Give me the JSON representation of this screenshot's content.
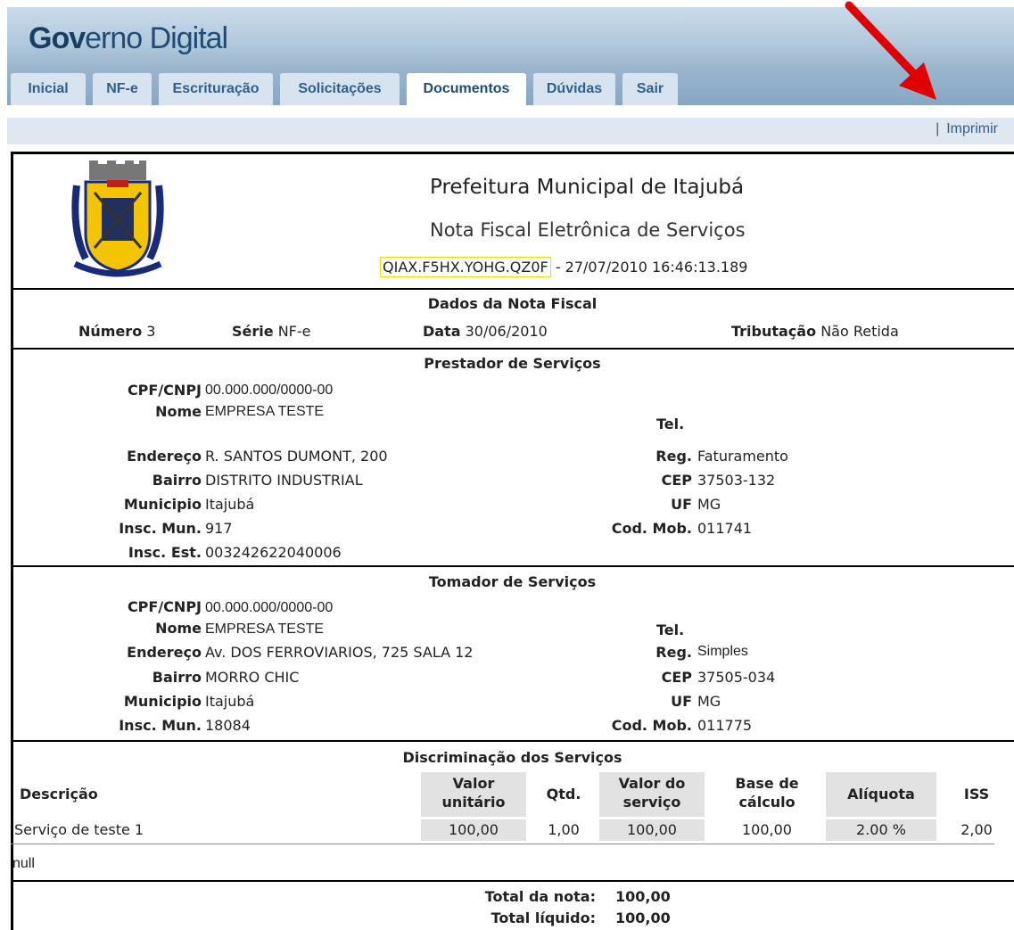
{
  "app": {
    "logo_bold": "Gov",
    "logo_rest": "erno Digital"
  },
  "tabs": [
    "Inicial",
    "NF-e",
    "Escrituração",
    "Solicitações",
    "Documentos",
    "Dúvidas",
    "Sair"
  ],
  "active_tab": "Documentos",
  "print_sep": "|",
  "print_label": "Imprimir",
  "header": {
    "title": "Prefeitura Municipal de Itajubá",
    "subtitle": "Nota Fiscal Eletrônica de Serviços",
    "code": "QIAX.F5HX.YOHG.QZ0F",
    "datetime": "- 27/07/2010 16:46:13.189"
  },
  "nota": {
    "section": "Dados da Nota Fiscal",
    "numero_label": "Número",
    "numero": "3",
    "serie_label": "Série",
    "serie": "NF-e",
    "data_label": "Data",
    "data": "30/06/2010",
    "trib_label": "Tributação",
    "trib": "Não Retida"
  },
  "prestador": {
    "section": "Prestador de Serviços",
    "cpf_label": "CPF/CNPJ",
    "cpf": "00.000.000/0000-00",
    "nome_label": "Nome",
    "nome": "EMPRESA TESTE",
    "tel_label": "Tel.",
    "end_label": "Endereço",
    "end": "R. SANTOS DUMONT, 200",
    "reg_label": "Reg.",
    "reg": "Faturamento",
    "bairro_label": "Bairro",
    "bairro": "DISTRITO INDUSTRIAL",
    "cep_label": "CEP",
    "cep": "37503-132",
    "mun_label": "Municipio",
    "mun": "Itajubá",
    "uf_label": "UF",
    "uf": "MG",
    "im_label": "Insc. Mun.",
    "im": "917",
    "cod_label": "Cod. Mob.",
    "cod": "011741",
    "ie_label": "Insc. Est.",
    "ie": "003242622040006"
  },
  "tomador": {
    "section": "Tomador de Serviços",
    "cpf_label": "CPF/CNPJ",
    "cpf": "00.000.000/0000-00",
    "nome_label": "Nome",
    "nome": "EMPRESA TESTE",
    "tel_label": "Tel.",
    "end_label": "Endereço",
    "end": "Av. DOS FERROVIARIOS, 725 SALA 12",
    "reg_label": "Reg.",
    "reg": "Simples",
    "bairro_label": "Bairro",
    "bairro": "MORRO CHIC",
    "cep_label": "CEP",
    "cep": "37505-034",
    "mun_label": "Municipio",
    "mun": "Itajubá",
    "uf_label": "UF",
    "uf": "MG",
    "im_label": "Insc. Mun.",
    "im": "18084",
    "cod_label": "Cod. Mob.",
    "cod": "011775"
  },
  "servicos": {
    "section": "Discriminação dos Serviços",
    "h_desc": "Descrição",
    "h_valor1": "Valor",
    "h_valor2": "unitário",
    "h_qtd": "Qtd.",
    "h_vs1": "Valor do",
    "h_vs2": "serviço",
    "h_base1": "Base de",
    "h_base2": "cálculo",
    "h_aliq": "Alíquota",
    "h_iss": "ISS",
    "row": {
      "desc": "Serviço de teste 1",
      "valor": "100,00",
      "qtd": "1,00",
      "vs": "100,00",
      "base": "100,00",
      "aliq": "2.00 %",
      "iss": "2,00"
    },
    "obs": "null"
  },
  "totais": {
    "total_label": "Total da nota:",
    "total": "100,00",
    "liquido_label": "Total líquido:",
    "liquido": "100,00"
  }
}
